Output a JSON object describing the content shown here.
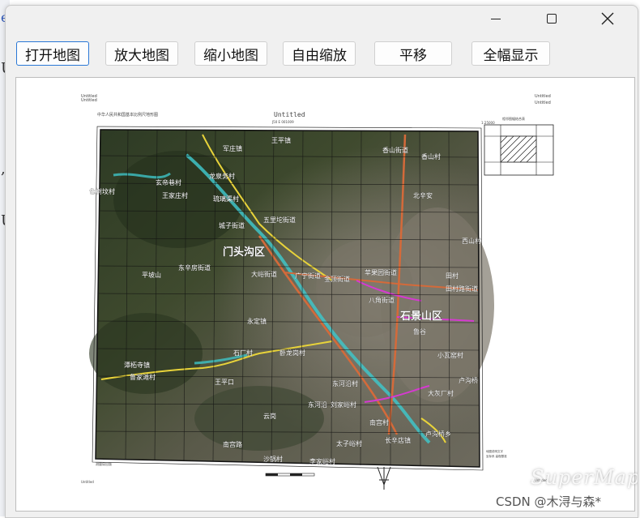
{
  "window": {
    "controls": {
      "minimize": "minimize-icon",
      "maximize": "maximize-icon",
      "close": "close-icon"
    }
  },
  "toolbar": {
    "open_map": "打开地图",
    "zoom_in": "放大地图",
    "zoom_out": "缩小地图",
    "free_zoom": "自由缩放",
    "pan": "平移",
    "full_extent": "全幅显示"
  },
  "background": {
    "chars": [
      "e",
      "U",
      ",",
      "U"
    ]
  },
  "map": {
    "title": "Untitled",
    "header_left": "Untitled",
    "header_right": "Untitled",
    "footer_right": "Untitled",
    "places": [
      "军庄镇",
      "王平镇",
      "香山街道",
      "香山村",
      "玄帝巷村",
      "龙泉务村",
      "东辛房街道",
      "门头沟区",
      "琉璃渠村",
      "色树坟村",
      "王家庄村",
      "城子街道",
      "大峪街道",
      "五里坨街道",
      "广宁街道",
      "金顶街道",
      "苹果园街道",
      "田村",
      "八角街道",
      "石景山区",
      "鲁谷",
      "小瓦窑村",
      "卢沟桥",
      "永定镇",
      "潭柘寺镇",
      "卧龙岗村",
      "大灰厂村",
      "东河沿村",
      "长辛店镇",
      "卢沟桥乡",
      "南宫村",
      "太子峪村",
      "云岗",
      "西山村",
      "沙锅村",
      "李家峪村",
      "平坡山",
      "北辛安",
      "南宫路",
      "鲁家滩村",
      "刘家峪村",
      "东河沿",
      "石厂村",
      "王平口",
      "田村路街道"
    ],
    "labels": {
      "district_mentougou": "门头沟区",
      "district_shijingshan": "石景山区",
      "csdn": "CSDN @木浔与森*",
      "brand": "SuperMap"
    }
  }
}
